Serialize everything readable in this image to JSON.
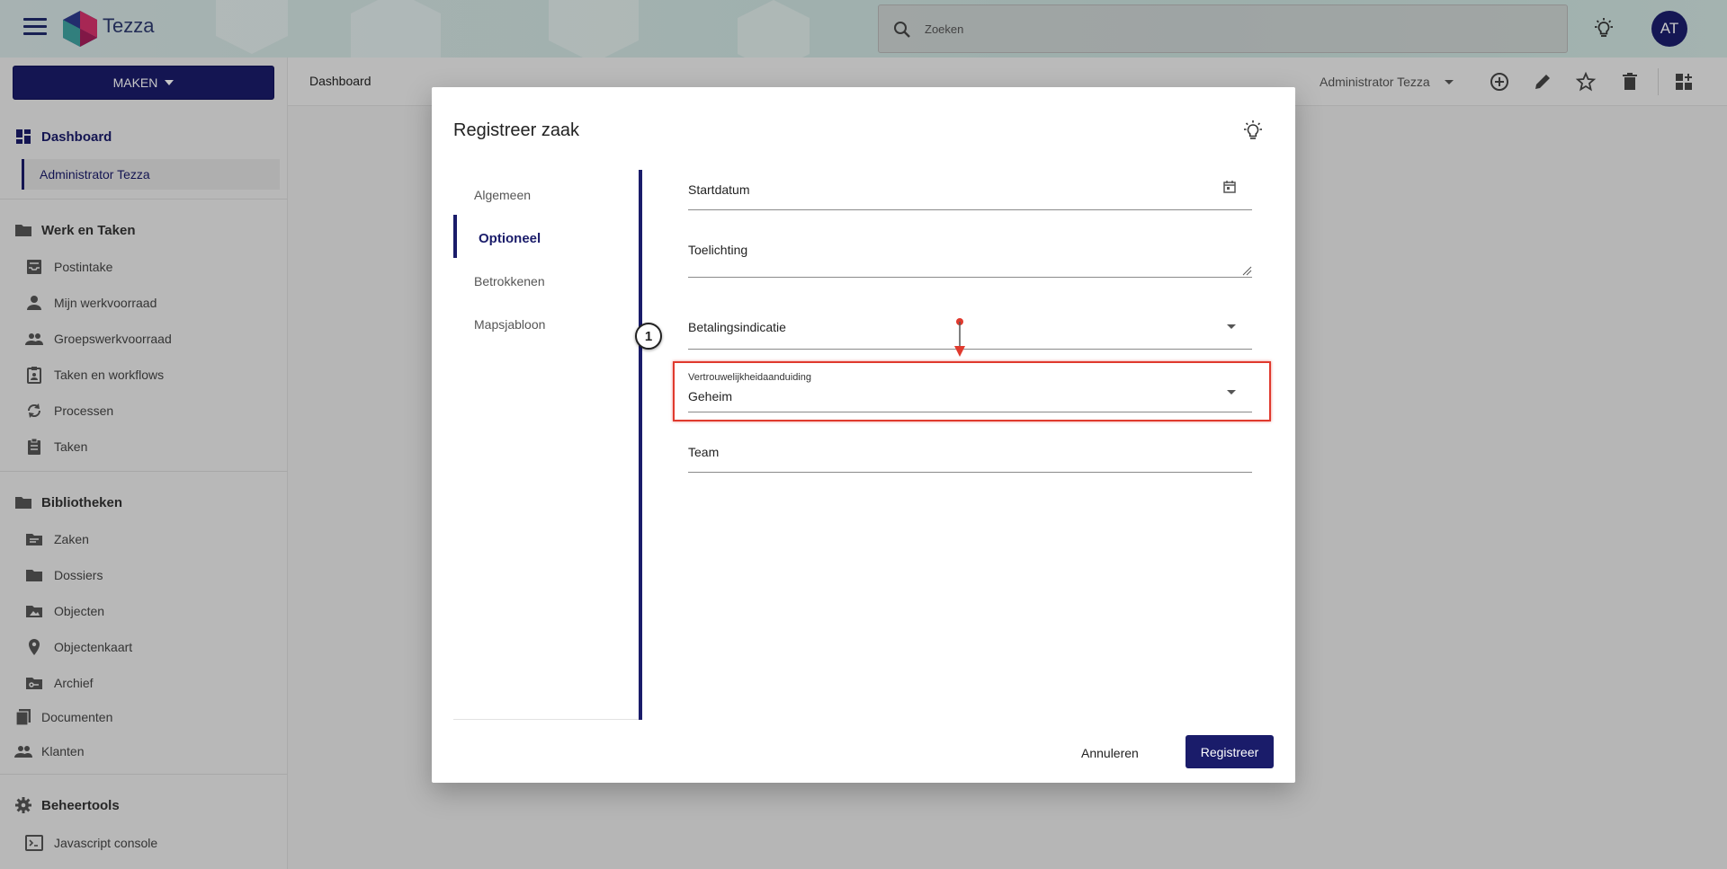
{
  "header": {
    "brand": "Tezza",
    "search_placeholder": "Zoeken",
    "avatar_initials": "AT"
  },
  "sidebar": {
    "create_button": "MAKEN",
    "dashboard": "Dashboard",
    "dashboard_sub": "Administrator Tezza",
    "werk_title": "Werk en Taken",
    "werk_items": [
      "Postintake",
      "Mijn werkvoorraad",
      "Groepswerkvoorraad",
      "Taken en workflows",
      "Processen",
      "Taken"
    ],
    "bieb_title": "Bibliotheken",
    "bieb_items": [
      "Zaken",
      "Dossiers",
      "Objecten",
      "Objectenkaart",
      "Archief"
    ],
    "documenten": "Documenten",
    "klanten": "Klanten",
    "beheer_title": "Beheertools",
    "beheer_items": [
      "Javascript console"
    ]
  },
  "main": {
    "breadcrumb": "Dashboard",
    "user_select": "Administrator Tezza"
  },
  "dialog": {
    "title": "Registreer zaak",
    "steps": [
      "Algemeen",
      "Optioneel",
      "Betrokkenen",
      "Mapsjabloon"
    ],
    "active_step": "Optioneel",
    "fields": {
      "startdatum": "Startdatum",
      "toelichting": "Toelichting",
      "betalingsindicatie": "Betalingsindicatie",
      "vertrouwelijkheid_label": "Vertrouwelijkheidaanduiding",
      "vertrouwelijkheid_value": "Geheim",
      "team": "Team"
    },
    "annotation_number": "1",
    "cancel_button": "Annuleren",
    "register_button": "Registreer"
  },
  "colors": {
    "primary": "#1a1c6a",
    "highlight": "#e03a2e"
  }
}
